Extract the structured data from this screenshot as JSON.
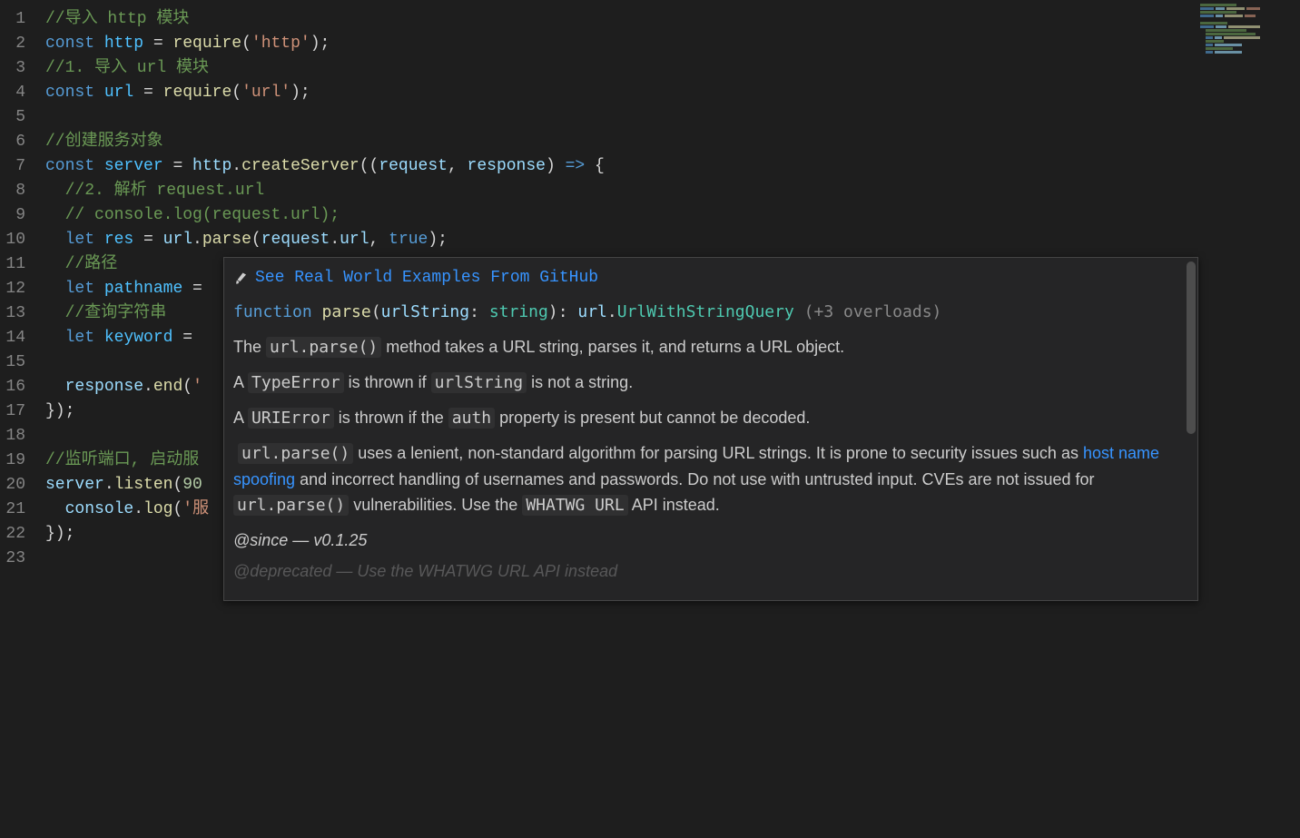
{
  "editor": {
    "line_numbers": [
      "1",
      "2",
      "3",
      "4",
      "5",
      "6",
      "7",
      "8",
      "9",
      "10",
      "11",
      "12",
      "13",
      "14",
      "15",
      "16",
      "17",
      "18",
      "19",
      "20",
      "21",
      "22",
      "23"
    ],
    "lines": {
      "l1": {
        "comment": "//导入 http 模块"
      },
      "l2": {
        "kw": "const",
        "var": "http",
        "punct1": " = ",
        "func": "require",
        "paren_open": "(",
        "str": "'http'",
        "paren_close": ")",
        "semi": ";"
      },
      "l3": {
        "comment": "//1. 导入 url 模块"
      },
      "l4": {
        "kw": "const",
        "var": "url",
        "punct1": " = ",
        "func": "require",
        "paren_open": "(",
        "str": "'url'",
        "paren_close": ")",
        "semi": ";"
      },
      "l5": {},
      "l6": {
        "comment": "//创建服务对象"
      },
      "l7": {
        "kw": "const",
        "var": "server",
        "punct1": " = ",
        "obj": "http",
        "dot": ".",
        "method": "createServer",
        "paren_open": "((",
        "arg1": "request",
        "comma": ", ",
        "arg2": "response",
        "paren_close": ")",
        "arrow": " => ",
        "brace": "{"
      },
      "l8": {
        "indent": "  ",
        "comment": "//2. 解析 request.url"
      },
      "l9": {
        "indent": "  ",
        "comment": "// console.log(request.url);"
      },
      "l10": {
        "indent": "  ",
        "kw": "let",
        "var": "res",
        "punct1": " = ",
        "obj": "url",
        "dot": ".",
        "method": "parse",
        "paren_open": "(",
        "arg1": "request",
        "dot2": ".",
        "prop": "url",
        "comma": ", ",
        "bool": "true",
        "paren_close": ")",
        "semi": ";"
      },
      "l11": {
        "indent": "  ",
        "comment": "//路径"
      },
      "l12": {
        "indent": "  ",
        "kw": "let",
        "var": "pathname",
        "punct1": " ="
      },
      "l13": {
        "indent": "  ",
        "comment": "//查询字符串"
      },
      "l14": {
        "indent": "  ",
        "kw": "let",
        "var": "keyword",
        "punct1": " ="
      },
      "l15": {},
      "l16": {
        "indent": "  ",
        "obj": "response",
        "dot": ".",
        "method": "end",
        "paren_open": "(",
        "str": "'"
      },
      "l17": {
        "brace": "});"
      },
      "l18": {},
      "l19": {
        "comment": "//监听端口, 启动服"
      },
      "l20": {
        "obj": "server",
        "dot": ".",
        "method": "listen",
        "paren_open": "(",
        "num": "90"
      },
      "l21": {
        "indent": "  ",
        "obj": "console",
        "dot": ".",
        "method": "log",
        "paren_open": "(",
        "str": "'服"
      },
      "l22": {
        "brace": "});"
      },
      "l23": {}
    }
  },
  "hover": {
    "examples_link": "See Real World Examples From GitHub",
    "sig": {
      "kw": "function",
      "name": "parse",
      "paren_open": "(",
      "param": "urlString",
      "colon": ": ",
      "type": "string",
      "paren_close": ")",
      "ret_colon": ": ",
      "ret_ns": "url",
      "ret_dot": ".",
      "ret_type": "UrlWithStringQuery",
      "overloads": " (+3 overloads)"
    },
    "p1_pre": "The ",
    "p1_code": "url.parse()",
    "p1_post": " method takes a URL string, parses it, and returns a URL object.",
    "p2_pre": "A ",
    "p2_code": "TypeError",
    "p2_mid": " is thrown if ",
    "p2_code2": "urlString",
    "p2_post": " is not a string.",
    "p3_pre": "A ",
    "p3_code": "URIError",
    "p3_mid": " is thrown if the ",
    "p3_code2": "auth",
    "p3_post": " property is present but cannot be decoded.",
    "p4_code": "url.parse()",
    "p4_a": " uses a lenient, non-standard algorithm for parsing URL strings. It is prone to security issues such as ",
    "p4_link": "host name spoofing",
    "p4_b": " and incorrect handling of usernames and passwords. Do not use with untrusted input. CVEs are not issued for ",
    "p4_code2": "url.parse()",
    "p4_c": " vulnerabilities. Use the ",
    "p4_code3": "WHATWG URL",
    "p4_d": " API instead.",
    "since_label": "@since",
    "since_dash": " — ",
    "since_val": "v0.1.25",
    "dep_label": "@deprecated",
    "dep_text": " — Use the WHATWG URL API instead"
  }
}
